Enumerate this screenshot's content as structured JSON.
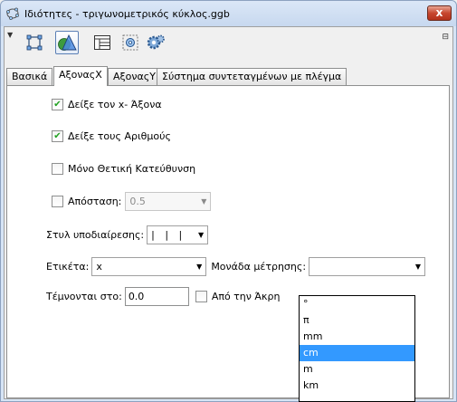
{
  "window": {
    "title": "Ιδιότητες - τριγωνομετρικός κύκλος.ggb",
    "close_label": "x"
  },
  "toolbar": {
    "icons": [
      "menu-arrow-icon",
      "points-icon",
      "polygon-object-icon",
      "layout-icon",
      "gear-grid-icon",
      "settings-gear-icon",
      "dock-icon"
    ]
  },
  "tabs": [
    {
      "label": "Βασικά"
    },
    {
      "label": "ΑξοναςX",
      "active": true
    },
    {
      "label": "ΑξοναςY"
    },
    {
      "label": "Σύστημα συντεταγμένων με πλέγμα"
    }
  ],
  "panel": {
    "show_axis": {
      "label": "Δείξε τον x- Άξονα",
      "checked": true
    },
    "show_numbers": {
      "label": "Δείξε τους Αριθμούς",
      "checked": true
    },
    "positive_only": {
      "label": "Μόνο Θετική Κατεύθυνση",
      "checked": false
    },
    "distance": {
      "label": "Απόσταση:",
      "checked": false,
      "value": "0.5"
    },
    "tick_style": {
      "label": "Στυλ υποδιαίρεσης:",
      "value": "| | |"
    },
    "label": {
      "label": "Ετικέτα:",
      "value": "x"
    },
    "unit": {
      "label": "Μονάδα μέτρησης:",
      "value": ""
    },
    "crossing": {
      "label": "Τέμνονται στο:",
      "value": "0.0"
    },
    "from_edge": {
      "label": "Από την Άκρη",
      "checked": false
    }
  },
  "unit_options": [
    "°",
    "π",
    "mm",
    "cm",
    "m",
    "km"
  ],
  "unit_selected_index": 3,
  "colors": {
    "selection": "#3399ff",
    "check": "#21a121",
    "close": "#c7472f"
  }
}
